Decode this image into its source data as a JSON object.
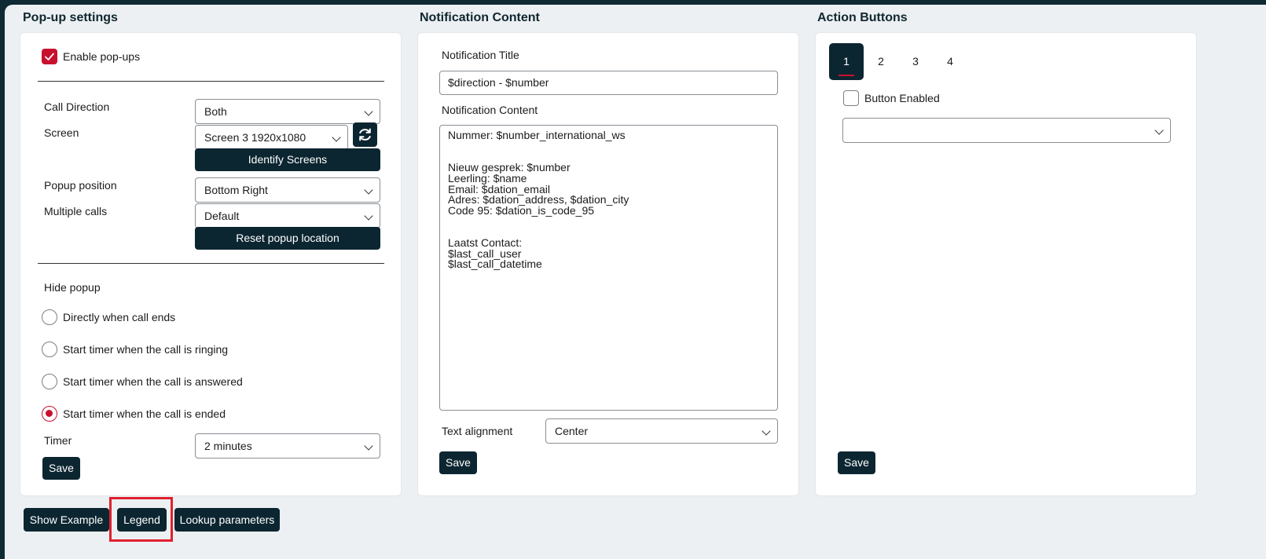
{
  "popup_settings": {
    "title": "Pop-up settings",
    "enable_label": "Enable pop-ups",
    "enable_checked": true,
    "call_direction_label": "Call Direction",
    "call_direction_value": "Both",
    "screen_label": "Screen",
    "screen_value": "Screen 3 1920x1080",
    "identify_screens": "Identify Screens",
    "popup_position_label": "Popup position",
    "popup_position_value": "Bottom Right",
    "multiple_calls_label": "Multiple calls",
    "multiple_calls_value": "Default",
    "reset_location": "Reset popup location",
    "hide_popup_label": "Hide popup",
    "hide_options": [
      {
        "label": "Directly when call ends",
        "selected": false
      },
      {
        "label": "Start timer when the call is ringing",
        "selected": false
      },
      {
        "label": "Start timer when the call is answered",
        "selected": false
      },
      {
        "label": "Start timer when the call is ended",
        "selected": true
      }
    ],
    "timer_label": "Timer",
    "timer_value": "2 minutes",
    "save": "Save"
  },
  "notification": {
    "title": "Notification Content",
    "title_label": "Notification Title",
    "title_value": "$direction - $number",
    "content_label": "Notification Content",
    "content_value": "Nummer: $number_international_ws\n\n\nNieuw gesprek: $number\nLeerling: $name\nEmail: $dation_email\nAdres: $dation_address, $dation_city\nCode 95: $dation_is_code_95\n\n\nLaatst Contact:\n$last_call_user\n$last_call_datetime",
    "alignment_label": "Text alignment",
    "alignment_value": "Center",
    "save": "Save"
  },
  "action_buttons": {
    "title": "Action Buttons",
    "tabs": [
      "1",
      "2",
      "3",
      "4"
    ],
    "active_tab": "1",
    "button_enabled_label": "Button Enabled",
    "button_enabled_checked": false,
    "action_select_value": "",
    "save": "Save"
  },
  "footer": {
    "show_example": "Show Example",
    "legend": "Legend",
    "lookup_parameters": "Lookup parameters"
  },
  "colors": {
    "accent_red": "#c8102e",
    "dark_button": "#0c2631",
    "page_bg": "#ecf0f2",
    "highlight_box": "#e0202e"
  }
}
